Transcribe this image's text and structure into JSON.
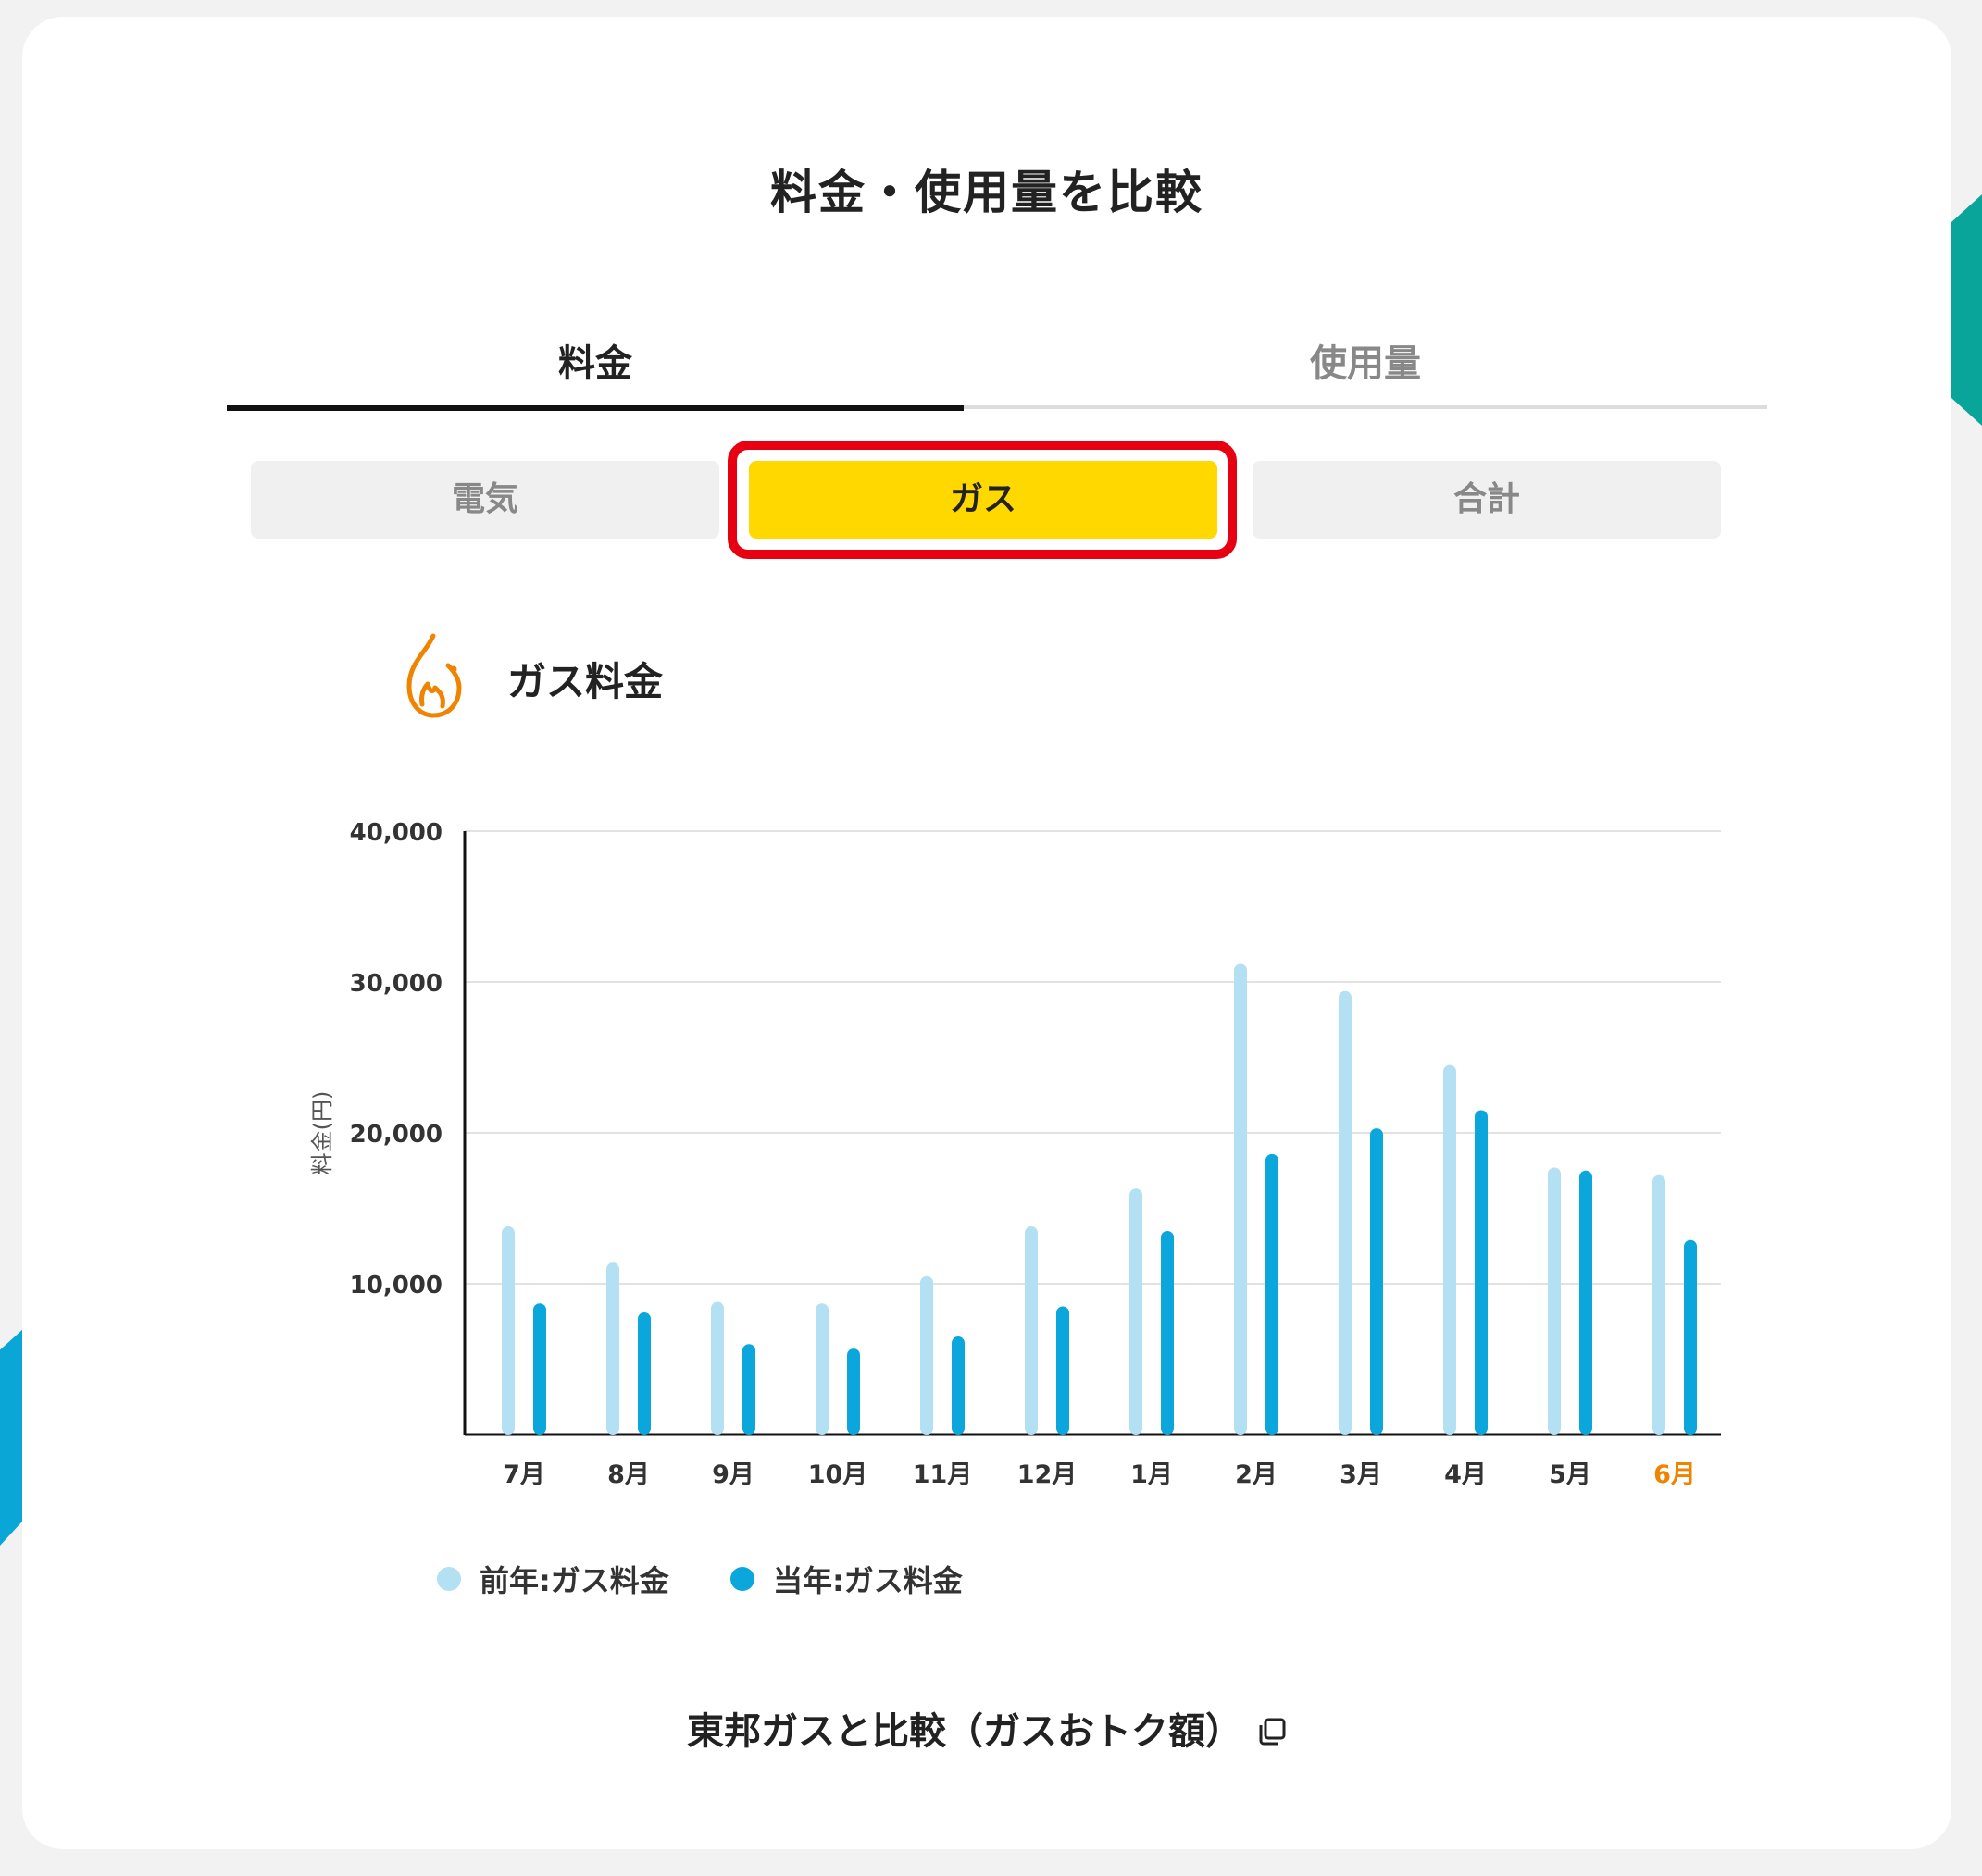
{
  "page": {
    "title": "料金・使用量を比較"
  },
  "tabs": [
    {
      "label": "料金",
      "active": true
    },
    {
      "label": "使用量",
      "active": false
    }
  ],
  "segments": [
    {
      "label": "電気",
      "selected": false
    },
    {
      "label": "ガス",
      "selected": true
    },
    {
      "label": "合計",
      "selected": false
    }
  ],
  "section": {
    "title": "ガス料金",
    "icon": "flame-icon"
  },
  "colors": {
    "accent": "#ffd800",
    "highlight": "#e60012",
    "prev_year": "#b3e0f2",
    "curr_year": "#0aa6dc",
    "flame": "#f08300",
    "current_month": "#f08300"
  },
  "chart_data": {
    "type": "bar",
    "ylabel": "料金(円)",
    "ylim": [
      0,
      40000
    ],
    "yticks": [
      "40,000",
      "30,000",
      "20,000",
      "10,000"
    ],
    "categories": [
      "7月",
      "8月",
      "9月",
      "10月",
      "11月",
      "12月",
      "1月",
      "2月",
      "3月",
      "4月",
      "5月",
      "6月"
    ],
    "highlighted_category": "6月",
    "series": [
      {
        "name": "前年:ガス料金",
        "values": [
          13800,
          11400,
          8800,
          8700,
          10500,
          13800,
          16300,
          31200,
          29400,
          24500,
          17700,
          17200
        ]
      },
      {
        "name": "当年:ガス料金",
        "values": [
          8700,
          8100,
          6000,
          5700,
          6500,
          8500,
          13500,
          18600,
          20300,
          21500,
          17500,
          12900
        ]
      }
    ],
    "grid": true,
    "legend_position": "bottom-left"
  },
  "footer": {
    "compare_link": "東邦ガスと比較（ガスおトク額）",
    "compare_icon": "external-link-icon"
  }
}
